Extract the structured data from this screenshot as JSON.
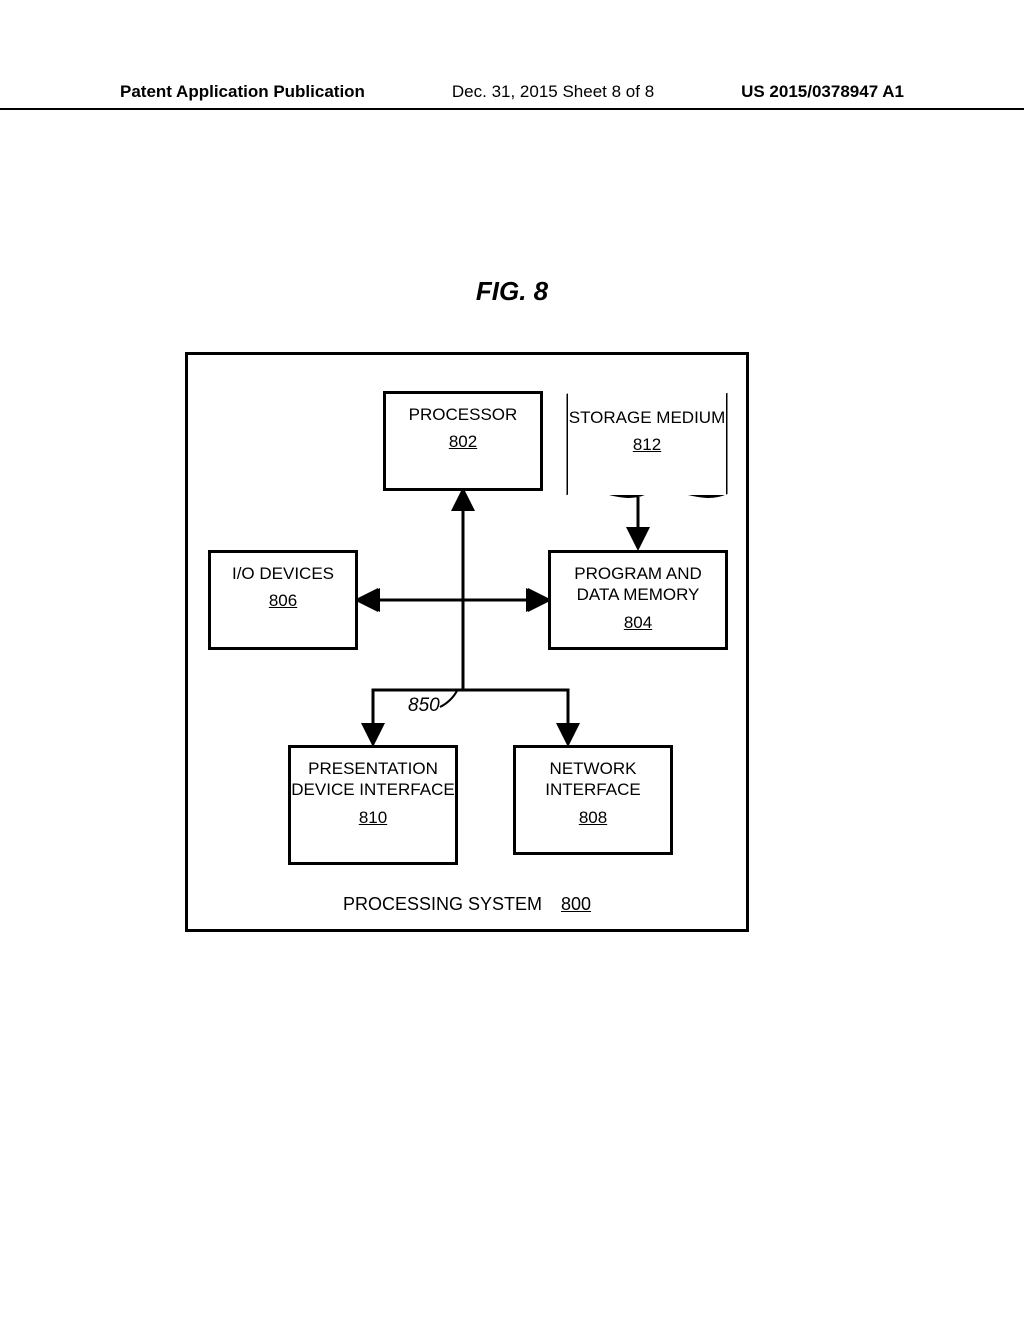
{
  "header": {
    "left": "Patent Application Publication",
    "middle": "Dec. 31, 2015   Sheet 8 of 8",
    "right": "US 2015/0378947 A1"
  },
  "figure_title": "FIG. 8",
  "system": {
    "caption_label": "PROCESSING SYSTEM",
    "caption_ref": "800"
  },
  "nodes": {
    "processor": {
      "label": "PROCESSOR",
      "ref": "802"
    },
    "storage": {
      "label": "STORAGE MEDIUM",
      "ref": "812"
    },
    "io": {
      "label": "I/O DEVICES",
      "ref": "806"
    },
    "memory": {
      "label": "PROGRAM AND DATA MEMORY",
      "ref": "804"
    },
    "present": {
      "label": "PRESENTATION DEVICE INTERFACE",
      "ref": "810"
    },
    "network": {
      "label": "NETWORK INTERFACE",
      "ref": "808"
    }
  },
  "interconnect_label": "850"
}
